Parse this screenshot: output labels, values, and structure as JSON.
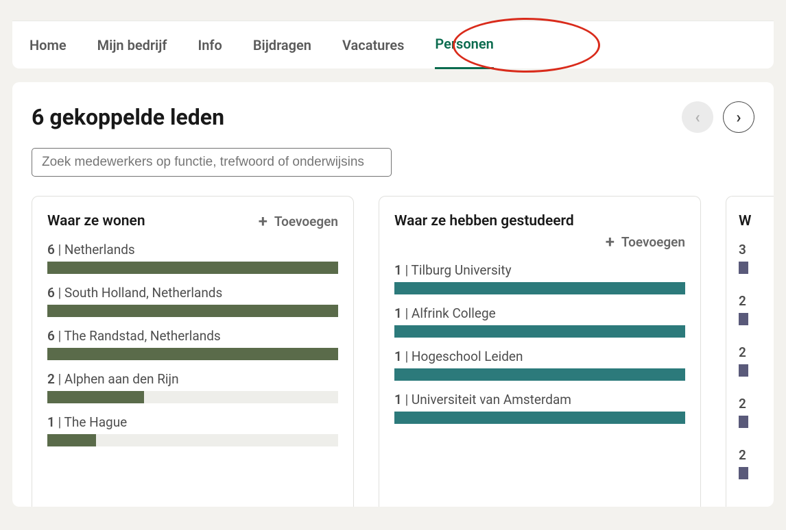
{
  "nav": {
    "items": [
      {
        "label": "Home",
        "active": false
      },
      {
        "label": "Mijn bedrijf",
        "active": false
      },
      {
        "label": "Info",
        "active": false
      },
      {
        "label": "Bijdragen",
        "active": false
      },
      {
        "label": "Vacatures",
        "active": false
      },
      {
        "label": "Personen",
        "active": true
      }
    ]
  },
  "page": {
    "title": "6 gekoppelde leden",
    "search_placeholder": "Zoek medewerkers op functie, trefwoord of onderwijsins"
  },
  "pager": {
    "prev": "‹",
    "next": "›"
  },
  "add_label": "Toevoegen",
  "panels": {
    "location": {
      "title": "Waar ze wonen",
      "max": 6,
      "items": [
        {
          "count": 6,
          "label": "Netherlands"
        },
        {
          "count": 6,
          "label": "South Holland, Netherlands"
        },
        {
          "count": 6,
          "label": "The Randstad, Netherlands"
        },
        {
          "count": 2,
          "label": "Alphen aan den Rijn"
        },
        {
          "count": 1,
          "label": "The Hague"
        }
      ]
    },
    "education": {
      "title": "Waar ze hebben gestudeerd",
      "max": 1,
      "items": [
        {
          "count": 1,
          "label": "Tilburg University"
        },
        {
          "count": 1,
          "label": "Alfrink College"
        },
        {
          "count": 1,
          "label": "Hogeschool Leiden"
        },
        {
          "count": 1,
          "label": "Universiteit van Amsterdam"
        }
      ]
    },
    "third": {
      "title": "W",
      "items": [
        {
          "count": 3
        },
        {
          "count": 2
        },
        {
          "count": 2
        },
        {
          "count": 2
        },
        {
          "count": 2
        }
      ]
    }
  }
}
